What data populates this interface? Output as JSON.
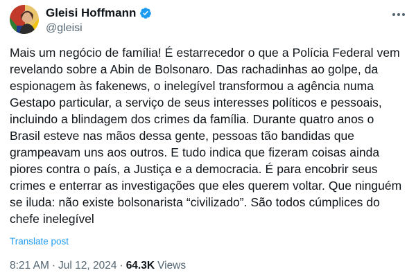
{
  "author": {
    "display_name": "Gleisi Hoffmann",
    "handle": "@gleisi",
    "avatar_icon": "profile-photo-avatar",
    "verified_icon": "verified-badge-icon",
    "verified_color": "#1d9bf0"
  },
  "more_icon": "more-options-icon",
  "post": {
    "lines": [
      "Mais um negócio de família! É estarrecedor o que a Polícia Federal vem",
      "revelando sobre a Abin de Bolsonaro. Das rachadinhas ao golpe, da",
      "espionagem às fakenews, o inelegível transformou a agência numa",
      "Gestapo particular, a serviço de seus interesses políticos e pessoais,",
      "incluindo a blindagem dos crimes da família. Durante quatro anos o",
      "Brasil esteve nas mãos dessa gente, pessoas tão bandidas que",
      "grampeavam uns aos outros. E tudo indica que fizeram coisas ainda",
      "piores contra o país, a Justiça e a democracia. É para encobrir seus",
      "crimes e enterrar as investigações que eles querem voltar. Que ninguém",
      "se iluda: não existe bolsonarista “civilizado”. São todos cúmplices do",
      "chefe inelegível"
    ]
  },
  "translate_label": "Translate post",
  "meta": {
    "time": "8:21 AM",
    "separator": "·",
    "date": "Jul 12, 2024",
    "views_count": "64.3K",
    "views_label": "Views"
  },
  "colors": {
    "text": "#0f1419",
    "secondary": "#536471",
    "link": "#1d9bf0"
  }
}
